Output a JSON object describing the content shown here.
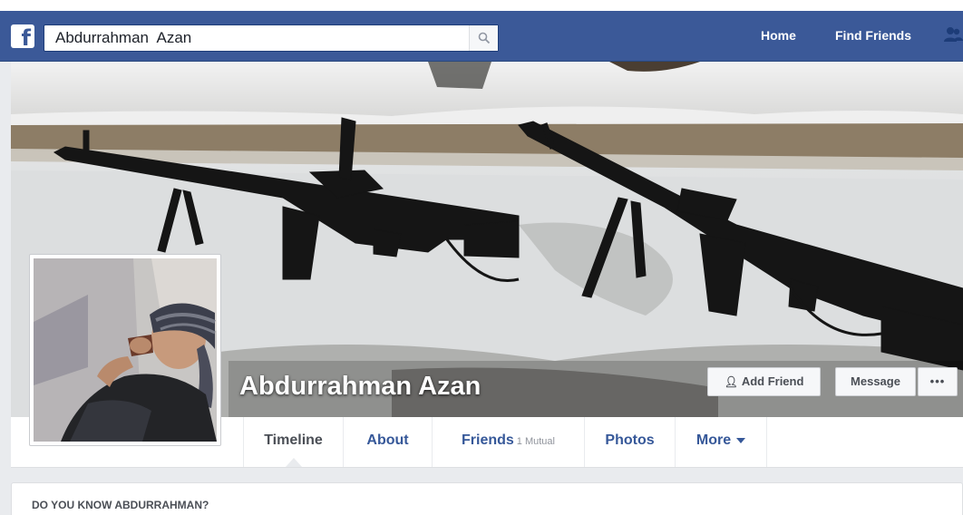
{
  "header": {
    "logo_icon": "facebook-f-icon",
    "logo_glyph": "f",
    "search_value": "Abdurrahman  Azan",
    "search_icon": "search-icon",
    "nav_home": "Home",
    "nav_find_friends": "Find Friends",
    "friend_requests_icon": "friend-requests-icon"
  },
  "profile": {
    "name": "Abdurrahman Azan",
    "add_friend_icon": "add-friend-icon",
    "add_friend_label": "Add Friend",
    "message_label": "Message",
    "more_label": "•••"
  },
  "tabs": [
    {
      "label": "Timeline"
    },
    {
      "label": "About"
    },
    {
      "label": "Friends",
      "count": "1 Mutual"
    },
    {
      "label": "Photos"
    },
    {
      "label": "More"
    }
  ],
  "card": {
    "title": "DO YOU KNOW ABDURRAHMAN?"
  },
  "colors": {
    "brand_blue": "#3b5998",
    "link_blue": "#365899",
    "page_bg": "#e9ebee"
  }
}
